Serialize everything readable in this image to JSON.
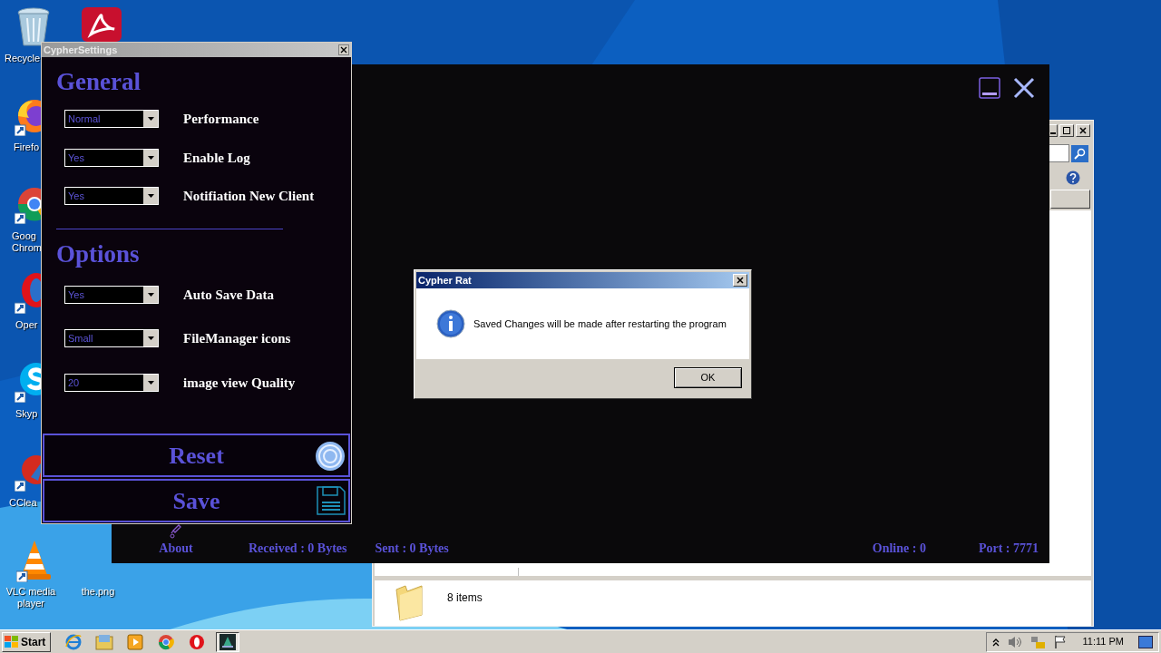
{
  "desktop_icons": [
    {
      "label": "Recycle",
      "kind": "recycle"
    },
    {
      "kind": "acrobat"
    },
    {
      "label": "Firefo",
      "kind": "firefox"
    },
    {
      "label": "Goog Chrom",
      "kind": "chrome"
    },
    {
      "label": "Oper",
      "kind": "opera"
    },
    {
      "label": "Skyp",
      "kind": "skype"
    },
    {
      "label": "CClea",
      "kind": "ccleaner"
    },
    {
      "label": "VLC media player",
      "kind": "vlc"
    },
    {
      "label": "the.png",
      "kind": "file"
    }
  ],
  "explorer": {
    "status": "8 items"
  },
  "main_window": {
    "status_bar": {
      "about": "About",
      "received": "Received : 0 Bytes",
      "sent": "Sent : 0 Bytes",
      "online": "Online : 0",
      "port": "Port : 7771"
    }
  },
  "settings_window": {
    "title": "CypherSettings",
    "sections": [
      {
        "heading": "General",
        "settings": [
          {
            "value": "Normal",
            "label": "Performance"
          },
          {
            "value": "Yes",
            "label": "Enable Log"
          },
          {
            "value": "Yes",
            "label": "Notifiation New Client"
          }
        ]
      },
      {
        "heading": "Options",
        "settings": [
          {
            "value": "Yes",
            "label": "Auto Save Data"
          },
          {
            "value": "Small",
            "label": "FileManager icons"
          },
          {
            "value": "20",
            "label": "image view Quality"
          }
        ]
      }
    ],
    "buttons": [
      {
        "label": "Reset",
        "kind": "reset"
      },
      {
        "label": "Save",
        "kind": "save"
      }
    ]
  },
  "dialog": {
    "title": "Cypher Rat",
    "message": "Saved Changes will be made after restarting the program",
    "button": "OK"
  },
  "taskbar": {
    "start": "Start",
    "apps": [
      {
        "kind": "ie",
        "selected": false
      },
      {
        "kind": "explorer",
        "selected": false
      },
      {
        "kind": "media",
        "selected": false
      },
      {
        "kind": "chrome",
        "selected": false
      },
      {
        "kind": "opera",
        "selected": false
      },
      {
        "kind": "cypher",
        "selected": true
      }
    ],
    "clock": "11:11 PM"
  }
}
